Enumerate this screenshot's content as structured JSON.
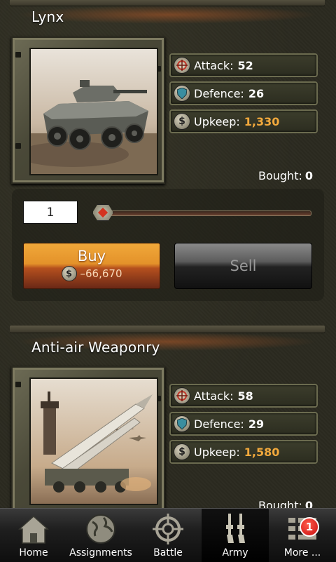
{
  "items": [
    {
      "name": "Lynx",
      "stats": {
        "attack_label": "Attack:",
        "attack": "52",
        "defence_label": "Defence:",
        "defence": "26",
        "upkeep_label": "Upkeep:",
        "upkeep": "1,330"
      },
      "bought_label": "Bought:",
      "bought": "0"
    },
    {
      "name": "Anti-air Weaponry",
      "stats": {
        "attack_label": "Attack:",
        "attack": "58",
        "defence_label": "Defence:",
        "defence": "29",
        "upkeep_label": "Upkeep:",
        "upkeep": "1,580"
      },
      "bought_label": "Bought:",
      "bought": "0"
    }
  ],
  "purchase": {
    "quantity": "1",
    "buy_label": "Buy",
    "buy_cost": "–66,670",
    "sell_label": "Sell"
  },
  "nav": {
    "items": [
      {
        "label": "Home",
        "icon": "home-icon"
      },
      {
        "label": "Assignments",
        "icon": "globe-icon"
      },
      {
        "label": "Battle",
        "icon": "crosshair-icon"
      },
      {
        "label": "Army",
        "icon": "rifles-icon",
        "active": true
      },
      {
        "label": "More ...",
        "icon": "list-icon",
        "badge": "1"
      }
    ]
  },
  "colors": {
    "upkeep_value": "#f2a93c",
    "buy_button": "#e4922a",
    "badge": "#d31616"
  }
}
